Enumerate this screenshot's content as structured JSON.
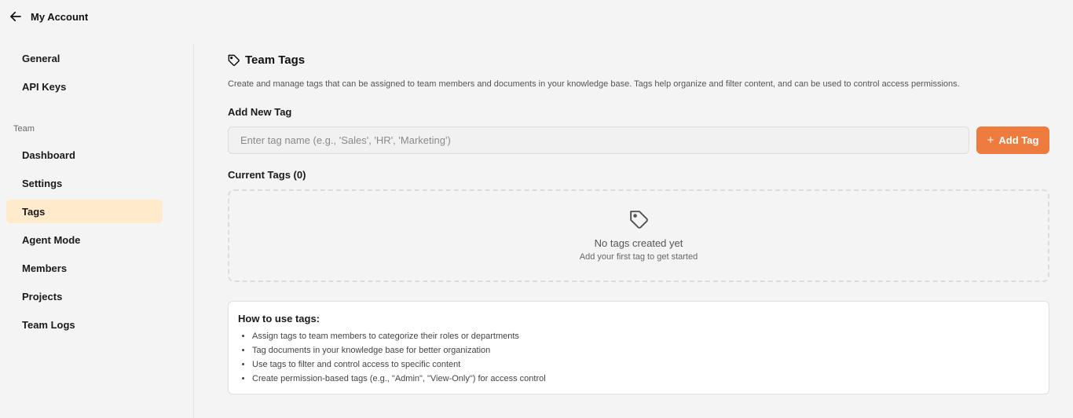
{
  "header": {
    "back_icon": "arrow-left-icon",
    "title": "My Account"
  },
  "sidebar": {
    "items_top": [
      {
        "label": "General"
      },
      {
        "label": "API Keys"
      }
    ],
    "section_label": "Team",
    "items_team": [
      {
        "label": "Dashboard"
      },
      {
        "label": "Settings"
      },
      {
        "label": "Tags",
        "active": true
      },
      {
        "label": "Agent Mode"
      },
      {
        "label": "Members"
      },
      {
        "label": "Projects"
      },
      {
        "label": "Team Logs"
      }
    ],
    "active_bg": "#ffeacc"
  },
  "main": {
    "title_icon": "tag-icon",
    "title": "Team Tags",
    "description": "Create and manage tags that can be assigned to team members and documents in your knowledge base. Tags help organize and filter content, and can be used to control access permissions.",
    "add_label": "Add New Tag",
    "input_placeholder": "Enter tag name (e.g., 'Sales', 'HR', 'Marketing')",
    "input_value": "",
    "add_button_icon": "plus-icon",
    "add_button_label": "Add Tag",
    "accent_color": "#ee7c3e",
    "current_label": "Current Tags (0)",
    "empty_icon": "tag-icon",
    "empty_title": "No tags created yet",
    "empty_subtitle": "Add your first tag to get started",
    "howto_title": "How to use tags:",
    "howto_items": [
      "Assign tags to team members to categorize their roles or departments",
      "Tag documents in your knowledge base for better organization",
      "Use tags to filter and control access to specific content",
      "Create permission-based tags (e.g., \"Admin\", \"View-Only\") for access control"
    ]
  }
}
